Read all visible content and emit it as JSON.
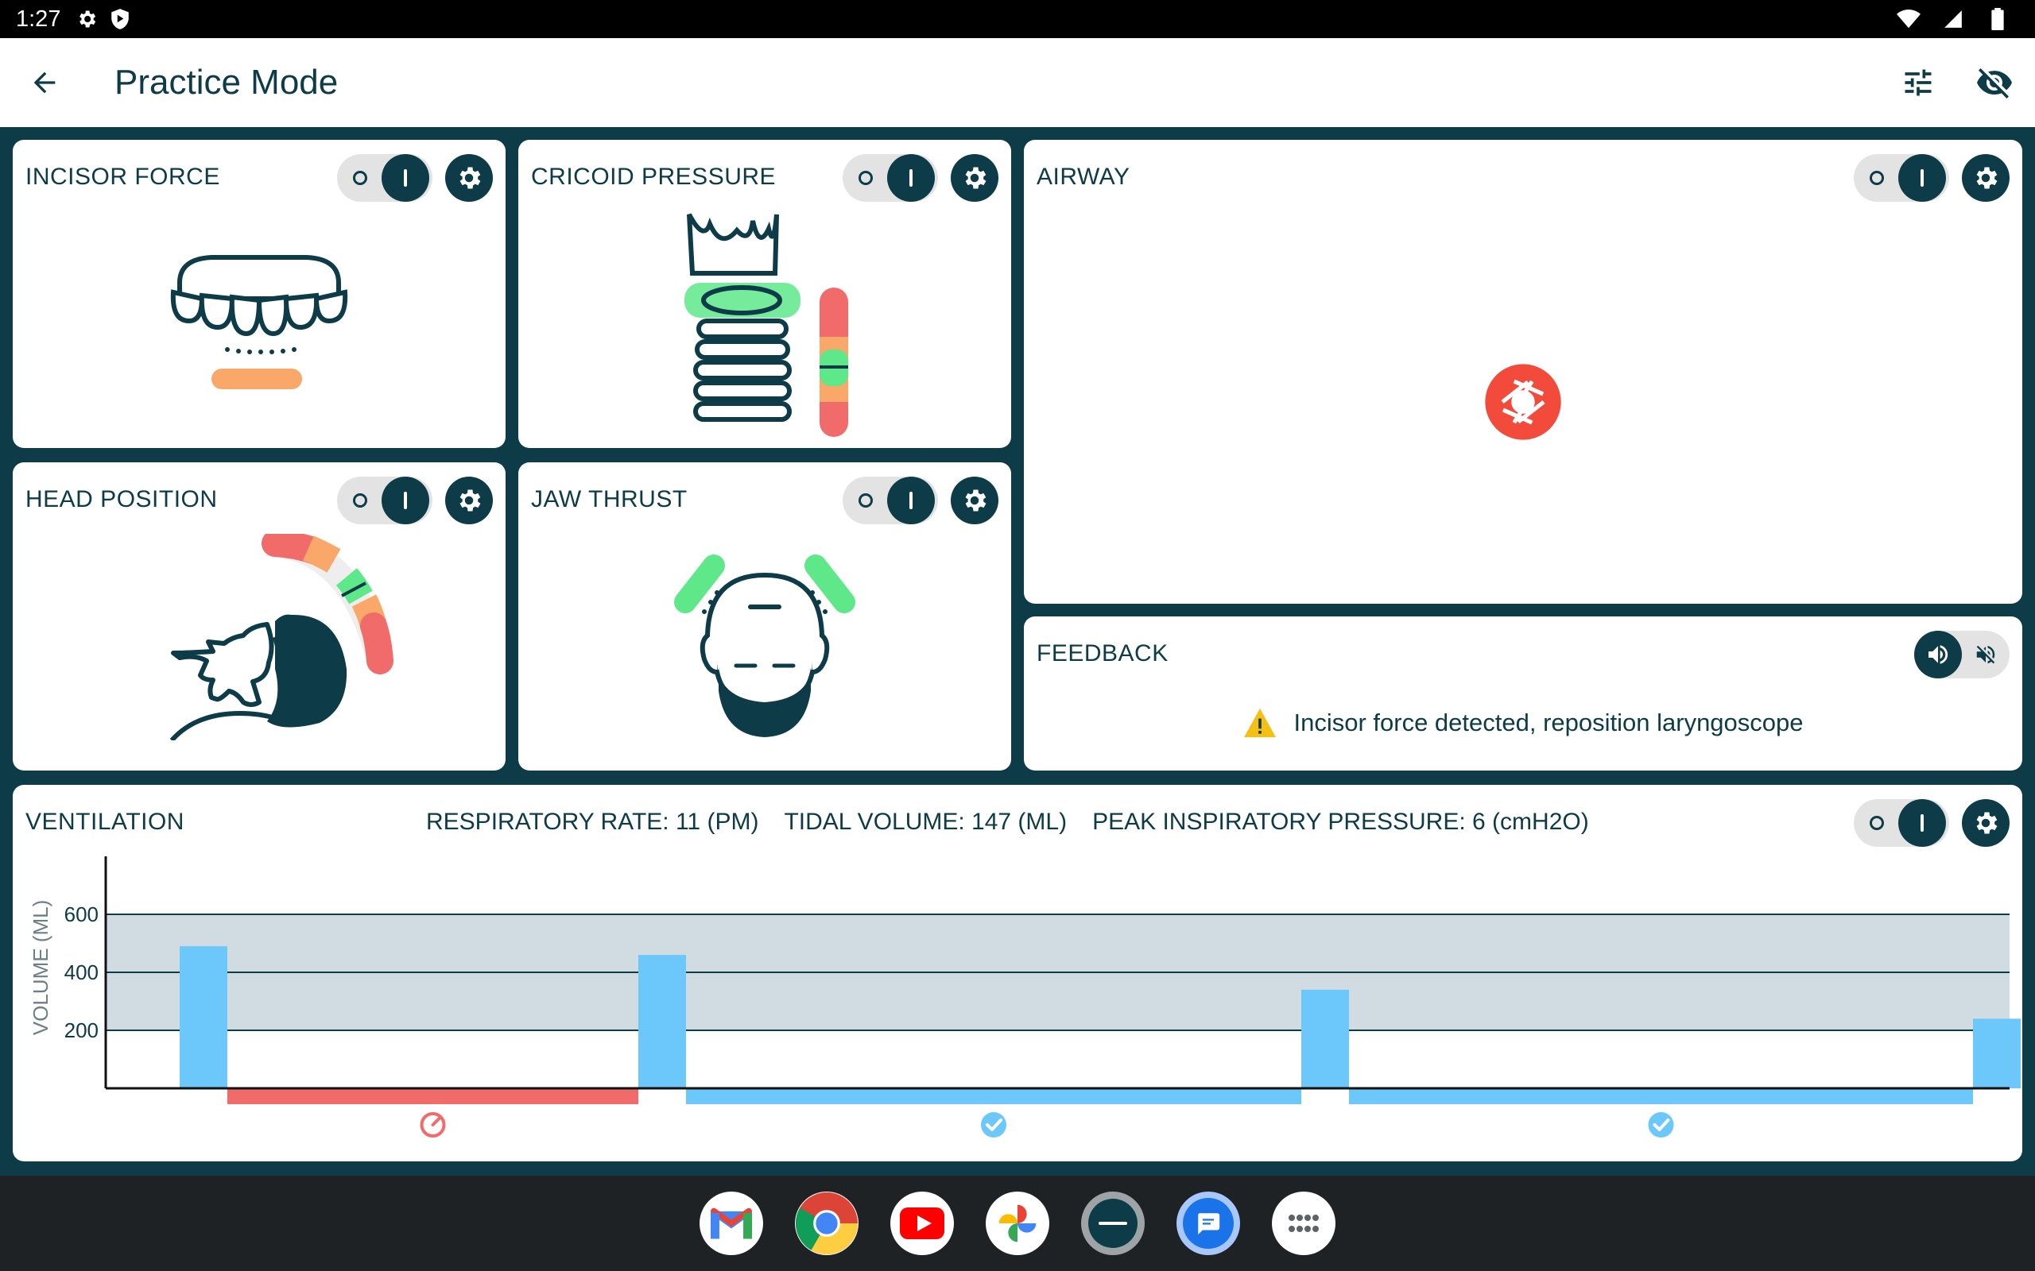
{
  "status": {
    "time": "1:27"
  },
  "appbar": {
    "title": "Practice Mode"
  },
  "panels": {
    "incisor": {
      "title": "INCISOR FORCE"
    },
    "cricoid": {
      "title": "CRICOID PRESSURE"
    },
    "airway": {
      "title": "AIRWAY"
    },
    "head": {
      "title": "HEAD POSITION"
    },
    "jaw": {
      "title": "JAW THRUST"
    },
    "feedback": {
      "title": "FEEDBACK",
      "message": "Incisor force detected, reposition laryngoscope"
    },
    "ventilation": {
      "title": "VENTILATION",
      "respiratory_rate": "RESPIRATORY RATE: 11 (PM)",
      "tidal_volume": "TIDAL VOLUME: 147 (ML)",
      "peak_pressure": "PEAK INSPIRATORY PRESSURE: 6 (cmH2O)",
      "ylabel": "VOLUME (ML)",
      "yticks": [
        "600",
        "400",
        "200"
      ]
    }
  },
  "colors": {
    "primary": "#0d3b47",
    "green": "#5ee88a",
    "red": "#f26b6b",
    "orange": "#f9a86a",
    "blue": "#6cc8fb",
    "band": "#d0dce1"
  },
  "chart_data": {
    "type": "bar",
    "ylabel": "VOLUME (ML)",
    "ylim": [
      0,
      800
    ],
    "target_band": [
      200,
      600
    ],
    "breaths": [
      {
        "volume": 490
      },
      {
        "volume": 460
      },
      {
        "volume": 340
      },
      {
        "volume": 240
      }
    ],
    "intervals": [
      {
        "status": "fast",
        "color": "#f26b6b",
        "icon": "speedometer-icon"
      },
      {
        "status": "ok",
        "color": "#6cc8fb",
        "icon": "check-circle-icon"
      },
      {
        "status": "ok",
        "color": "#6cc8fb",
        "icon": "check-circle-icon"
      }
    ]
  },
  "dock": {
    "apps": [
      "gmail-icon",
      "chrome-icon",
      "youtube-icon",
      "photos-icon",
      "trucorp-icon",
      "messages-icon",
      "app-drawer-icon"
    ]
  }
}
